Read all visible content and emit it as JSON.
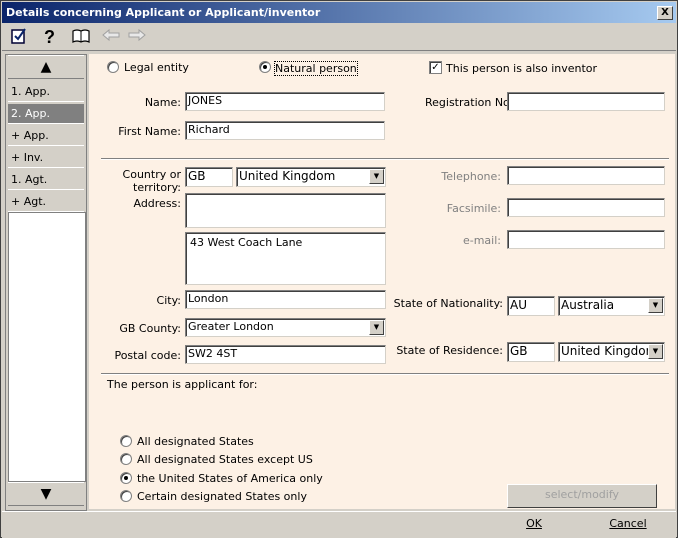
{
  "window": {
    "title": "Details concerning Applicant or Applicant/inventor",
    "close_label": "X"
  },
  "toolbar": {
    "icons": [
      "checklist-icon",
      "help-icon",
      "book-icon",
      "back-arrow-icon",
      "forward-arrow-icon"
    ]
  },
  "sidebar": {
    "up_arrow": "▲",
    "down_arrow": "▼",
    "items": [
      {
        "label": "1. App."
      },
      {
        "label": "2. App."
      },
      {
        "label": "+ App."
      },
      {
        "label": "+ Inv."
      },
      {
        "label": "1. Agt."
      },
      {
        "label": "+ Agt."
      }
    ]
  },
  "entity_type": {
    "legal_entity_label": "Legal entity",
    "natural_person_label": "Natural person",
    "selected": "natural_person",
    "also_inventor_label": "This person is also inventor",
    "also_inventor_checked": true,
    "check_mark": "✓"
  },
  "person": {
    "name_label": "Name:",
    "name_value": "JONES",
    "first_name_label": "First Name:",
    "first_name_value": "Richard",
    "registration_label": "Registration No.",
    "registration_value": ""
  },
  "address": {
    "country_label_1": "Country or",
    "country_label_2": "territory:",
    "country_code": "GB",
    "country_name": "United Kingdom",
    "address_label": "Address:",
    "address_line1": "",
    "address_line2": "43 West Coach Lane",
    "city_label": "City:",
    "city_value": "London",
    "county_label": "GB County:",
    "county_value": "Greater London",
    "postal_label": "Postal code:",
    "postal_value": "SW2 4ST"
  },
  "contact": {
    "telephone_label": "Telephone:",
    "facsimile_label": "Facsimile:",
    "email_label": "e-mail:"
  },
  "nationality": {
    "nationality_label": "State of Nationality:",
    "nationality_code": "AU",
    "nationality_name": "Australia",
    "residence_label": "State of Residence:",
    "residence_code": "GB",
    "residence_name": "United Kingdom"
  },
  "applicant_for": {
    "heading": "The person is applicant for:",
    "options": [
      {
        "label": "All designated States"
      },
      {
        "label": "All designated States except US"
      },
      {
        "label": "the United States of America only"
      },
      {
        "label": "Certain designated States only"
      }
    ],
    "selected_index": 2,
    "select_modify_label": "select/modify"
  },
  "footer": {
    "ok_label": "OK",
    "cancel_label": "Cancel"
  },
  "dropdown_glyph": "▼"
}
